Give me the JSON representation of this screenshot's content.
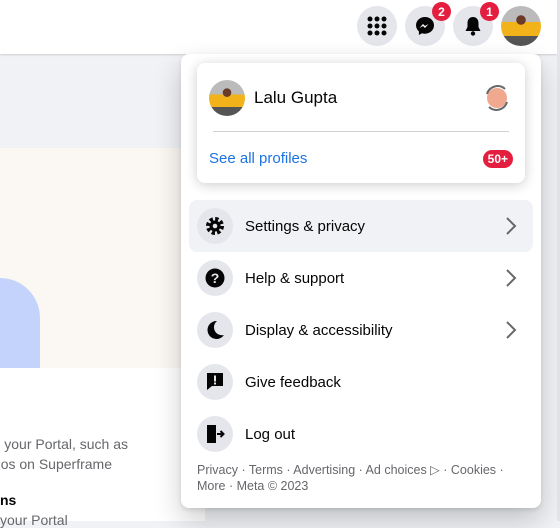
{
  "header": {
    "messenger_badge": "2",
    "notifications_badge": "1"
  },
  "background": {
    "text_lines": [
      "your Portal, such as",
      "os on Superframe",
      "ns",
      "your Portal"
    ]
  },
  "profile": {
    "name": "Lalu Gupta",
    "see_all": "See all profiles",
    "count_badge": "50+"
  },
  "menu": [
    {
      "label": "Settings & privacy",
      "icon": "gear-icon",
      "chevron": true
    },
    {
      "label": "Help & support",
      "icon": "question-icon",
      "chevron": true
    },
    {
      "label": "Display & accessibility",
      "icon": "moon-icon",
      "chevron": true
    },
    {
      "label": "Give feedback",
      "icon": "feedback-icon",
      "chevron": false
    },
    {
      "label": "Log out",
      "icon": "logout-icon",
      "chevron": false
    }
  ],
  "footer": {
    "line1": "Privacy · Terms · Advertising · Ad choices ▷ · Cookies ·",
    "line2": "More · Meta © 2023"
  },
  "colors": {
    "accent": "#1b74e4",
    "badge": "#e41e3f"
  }
}
